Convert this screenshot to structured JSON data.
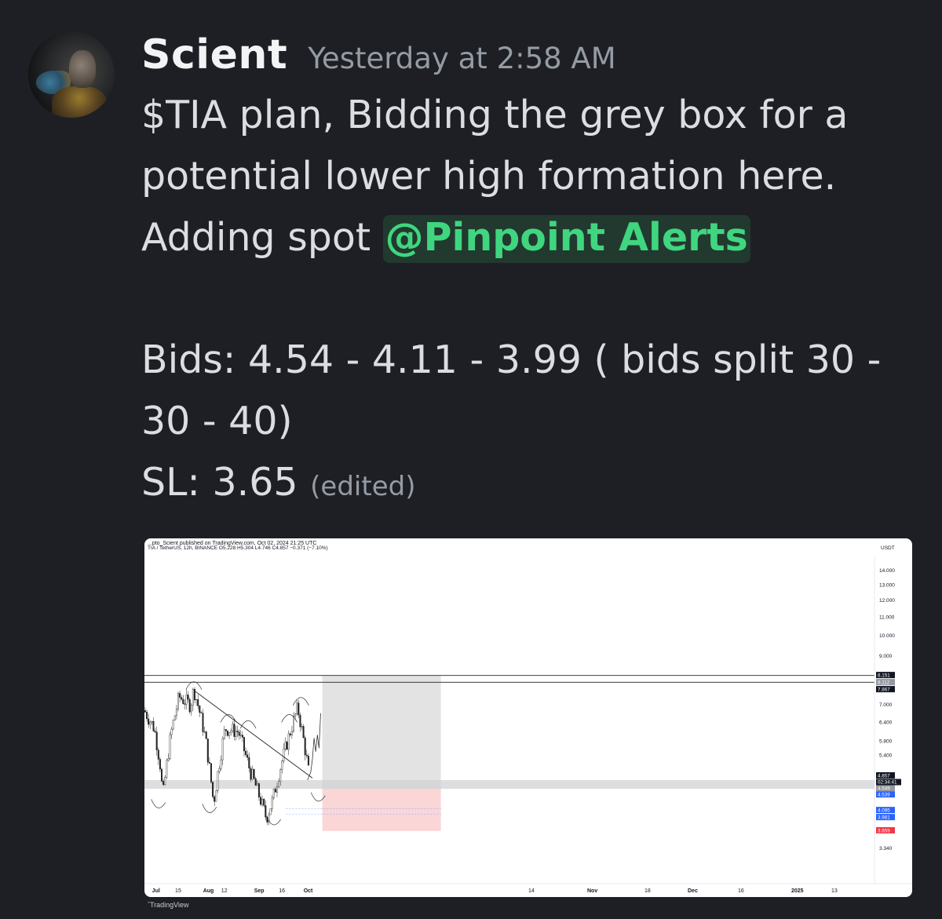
{
  "message": {
    "author": "Scient",
    "timestamp": "Yesterday at 2:58 AM",
    "lines": [
      "$TIA plan, Bidding the grey box for a",
      "potential lower high formation here."
    ],
    "line3_prefix": "Adding spot ",
    "mention": "@Pinpoint Alerts",
    "bids_line1": "Bids: 4.54 - 4.11 - 3.99 ( bids split 30 -",
    "bids_line2": "30 - 40)",
    "sl": "SL: 3.65",
    "edited": "(edited)"
  },
  "chart": {
    "published_by": "...pto_Scient published on TradingView.com, Oct 02, 2024 21:25 UTC",
    "symbol_info": "TIA / TetherUS, 12h, BINANCE  O5.228  H5.304  L4.746  C4.857  −0.371 (−7.10%)",
    "currency": "USDT",
    "footer": "TradingView",
    "colors": {
      "resistance_line": "#222222",
      "grey_box": "#cfd0d2",
      "projection_box": "#d9d9da",
      "stop_zone": "#f8c4c6",
      "current_price_tag": "#131722",
      "bid_tag": "#2962ff",
      "sl_tag": "#f23645"
    }
  },
  "chart_data": {
    "type": "candlestick",
    "y_scale": "log",
    "ylim": [
      3.2,
      15.5
    ],
    "y_ticks": [
      "14.000",
      "13.000",
      "12.000",
      "11.000",
      "10.000",
      "9.000",
      "7.000",
      "6.400",
      "5.800",
      "5.400",
      "3.340"
    ],
    "price_tags": [
      {
        "value": 8.151,
        "label": "8.151",
        "style": "dark"
      },
      {
        "value": 8.112,
        "label": "8.112",
        "style": "grey"
      },
      {
        "value": 7.867,
        "label": "7.867",
        "style": "dark"
      },
      {
        "value": 4.857,
        "label": "4.857",
        "style": "dark"
      },
      {
        "value": 4.549,
        "label": "4.549",
        "style": "grey"
      },
      {
        "value": 4.539,
        "label": "4.539",
        "style": "blue"
      },
      {
        "value": 4.095,
        "label": "4.095",
        "style": "blue"
      },
      {
        "value": 3.981,
        "label": "3.981",
        "style": "blue"
      },
      {
        "value": 3.659,
        "label": "3.659",
        "style": "red"
      }
    ],
    "countdown": "02:34:41",
    "x_ticks": [
      "Jul",
      "15",
      "Aug",
      "12",
      "Sep",
      "16",
      "Oct",
      "14",
      "Nov",
      "18",
      "Dec",
      "16",
      "2025",
      "13"
    ],
    "x_ticks_bold": [
      "Jul",
      "Aug",
      "Sep",
      "Oct",
      "Nov",
      "Dec",
      "2025"
    ],
    "resistance_levels": [
      8.15,
      7.87
    ],
    "bid_zone": [
      4.54,
      4.75
    ],
    "series": [
      {
        "date": "Jun 24",
        "close": 6.8
      },
      {
        "date": "Jun 30",
        "close": 6.2
      },
      {
        "date": "Jul 04",
        "close": 5.0
      },
      {
        "date": "Jul 05",
        "close": 4.3
      },
      {
        "date": "Jul 10",
        "close": 6.0
      },
      {
        "date": "Jul 15",
        "close": 7.3
      },
      {
        "date": "Jul 22",
        "close": 7.0
      },
      {
        "date": "Jul 24",
        "close": 7.6
      },
      {
        "date": "Jul 31",
        "close": 5.9
      },
      {
        "date": "Aug 05",
        "close": 4.2
      },
      {
        "date": "Aug 12",
        "close": 6.2
      },
      {
        "date": "Aug 20",
        "close": 6.1
      },
      {
        "date": "Aug 27",
        "close": 5.0
      },
      {
        "date": "Sep 06",
        "close": 3.9
      },
      {
        "date": "Sep 10",
        "close": 4.3
      },
      {
        "date": "Sep 20",
        "close": 6.0
      },
      {
        "date": "Sep 25",
        "close": 6.9
      },
      {
        "date": "Oct 02",
        "close": 4.857
      }
    ]
  }
}
